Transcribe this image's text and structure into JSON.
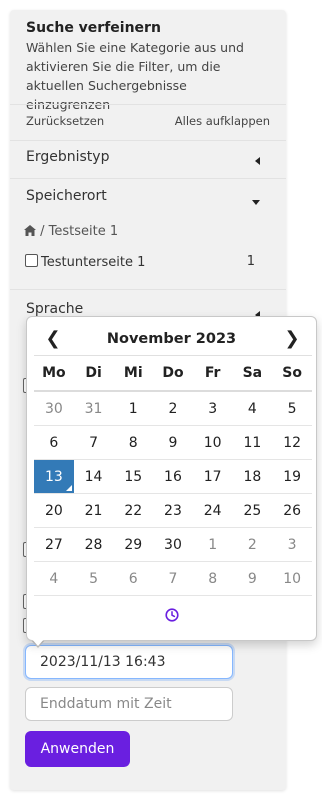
{
  "filter": {
    "title": "Suche verfeinern",
    "description": "Wählen Sie eine Kategorie aus und aktivieren Sie die Filter, um die aktuellen Suchergebnisse einzugrenzen",
    "reset_label": "Zurücksetzen",
    "expand_label": "Alles aufklappen",
    "sections": {
      "ergebnistyp": "Ergebnistyp",
      "speicherort": "Speicherort",
      "sprache": "Sprache"
    },
    "breadcrumb": {
      "separator": "/",
      "page": "Testseite 1"
    },
    "subpage": {
      "label": "Testunterseite 1",
      "count": "1"
    }
  },
  "date": {
    "start_value": "2023/11/13 16:43",
    "end_placeholder": "Enddatum mit Zeit"
  },
  "apply_label": "Anwenden",
  "calendar": {
    "month_label": "November 2023",
    "prev": "❮",
    "next": "❯",
    "weekdays": [
      "Mo",
      "Di",
      "Mi",
      "Do",
      "Fr",
      "Sa",
      "So"
    ],
    "weeks": [
      [
        "30",
        "31",
        "1",
        "2",
        "3",
        "4",
        "5"
      ],
      [
        "6",
        "7",
        "8",
        "9",
        "10",
        "11",
        "12"
      ],
      [
        "13",
        "14",
        "15",
        "16",
        "17",
        "18",
        "19"
      ],
      [
        "20",
        "21",
        "22",
        "23",
        "24",
        "25",
        "26"
      ],
      [
        "27",
        "28",
        "29",
        "30",
        "1",
        "2",
        "3"
      ],
      [
        "4",
        "5",
        "6",
        "7",
        "8",
        "9",
        "10"
      ]
    ],
    "selected_day": "13",
    "selected_color": "#337ab7"
  },
  "colors": {
    "accent": "#6a1fe0",
    "focus_border": "#86b7fe"
  },
  "icons": {
    "home": "home-icon",
    "clock": "clock-icon"
  }
}
